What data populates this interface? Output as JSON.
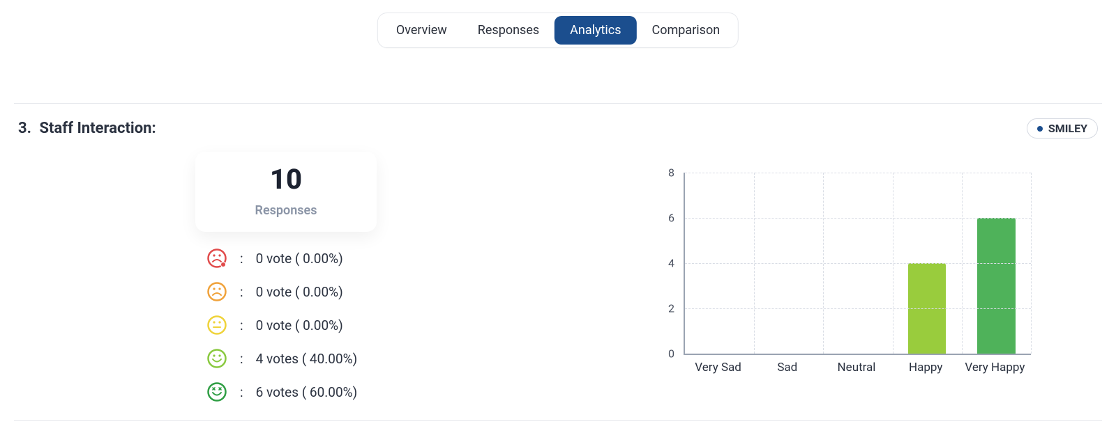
{
  "tabs": {
    "items": [
      {
        "label": "Overview",
        "active": false
      },
      {
        "label": "Responses",
        "active": false
      },
      {
        "label": "Analytics",
        "active": true
      },
      {
        "label": "Comparison",
        "active": false
      }
    ]
  },
  "badge": {
    "label": "SMILEY",
    "dot_color": "#1b4e8e"
  },
  "question": {
    "number": "3.",
    "title": "Staff Interaction:"
  },
  "summary": {
    "value": "10",
    "label": "Responses"
  },
  "legend": {
    "rows": [
      {
        "icon": "very-sad",
        "color": "#e14b4b",
        "text": "0 vote ( 0.00%)"
      },
      {
        "icon": "sad",
        "color": "#f0a23a",
        "text": "0 vote ( 0.00%)"
      },
      {
        "icon": "neutral",
        "color": "#efd33a",
        "text": "0 vote ( 0.00%)"
      },
      {
        "icon": "happy",
        "color": "#89c93f",
        "text": "4 votes ( 40.00%)"
      },
      {
        "icon": "very-happy",
        "color": "#2f9e44",
        "text": "6 votes ( 60.00%)"
      }
    ]
  },
  "chart_data": {
    "type": "bar",
    "categories": [
      "Very Sad",
      "Sad",
      "Neutral",
      "Happy",
      "Very Happy"
    ],
    "values": [
      0,
      0,
      0,
      4,
      6
    ],
    "colors": [
      "#e14b4b",
      "#f0a23a",
      "#efd33a",
      "#99cc3d",
      "#4fb25a"
    ],
    "ylabel": "",
    "xlabel": "",
    "ylim": [
      0,
      8
    ],
    "yticks": [
      0,
      2,
      4,
      6,
      8
    ],
    "title": ""
  }
}
